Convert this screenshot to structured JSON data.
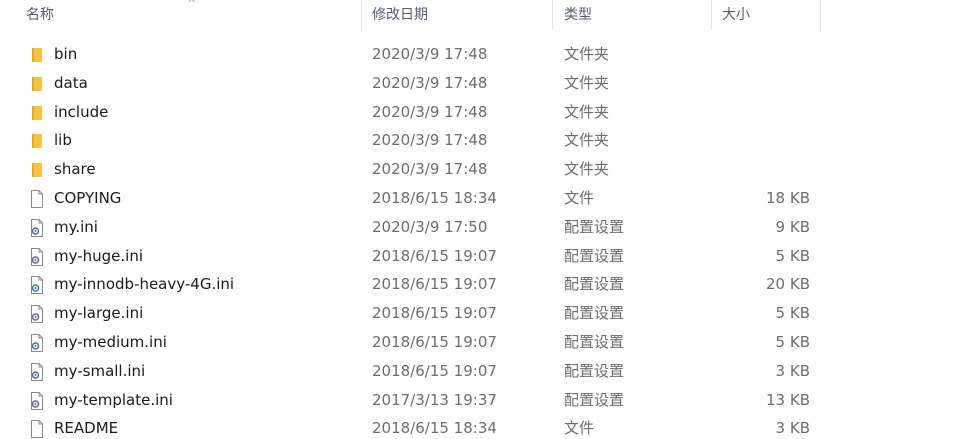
{
  "columns": {
    "name": "名称",
    "date": "修改日期",
    "type": "类型",
    "size": "大小"
  },
  "files": [
    {
      "name": "bin",
      "date": "2020/3/9 17:48",
      "type": "文件夹",
      "size": "",
      "icon": "folder-icon"
    },
    {
      "name": "data",
      "date": "2020/3/9 17:48",
      "type": "文件夹",
      "size": "",
      "icon": "folder-icon"
    },
    {
      "name": "include",
      "date": "2020/3/9 17:48",
      "type": "文件夹",
      "size": "",
      "icon": "folder-icon"
    },
    {
      "name": "lib",
      "date": "2020/3/9 17:48",
      "type": "文件夹",
      "size": "",
      "icon": "folder-icon"
    },
    {
      "name": "share",
      "date": "2020/3/9 17:48",
      "type": "文件夹",
      "size": "",
      "icon": "folder-icon"
    },
    {
      "name": "COPYING",
      "date": "2018/6/15 18:34",
      "type": "文件",
      "size": "18 KB",
      "icon": "file-icon"
    },
    {
      "name": "my.ini",
      "date": "2020/3/9 17:50",
      "type": "配置设置",
      "size": "9 KB",
      "icon": "settings-file-icon"
    },
    {
      "name": "my-huge.ini",
      "date": "2018/6/15 19:07",
      "type": "配置设置",
      "size": "5 KB",
      "icon": "settings-file-icon"
    },
    {
      "name": "my-innodb-heavy-4G.ini",
      "date": "2018/6/15 19:07",
      "type": "配置设置",
      "size": "20 KB",
      "icon": "settings-file-icon"
    },
    {
      "name": "my-large.ini",
      "date": "2018/6/15 19:07",
      "type": "配置设置",
      "size": "5 KB",
      "icon": "settings-file-icon"
    },
    {
      "name": "my-medium.ini",
      "date": "2018/6/15 19:07",
      "type": "配置设置",
      "size": "5 KB",
      "icon": "settings-file-icon"
    },
    {
      "name": "my-small.ini",
      "date": "2018/6/15 19:07",
      "type": "配置设置",
      "size": "3 KB",
      "icon": "settings-file-icon"
    },
    {
      "name": "my-template.ini",
      "date": "2017/3/13 19:37",
      "type": "配置设置",
      "size": "13 KB",
      "icon": "settings-file-icon"
    },
    {
      "name": "README",
      "date": "2018/6/15 18:34",
      "type": "文件",
      "size": "3 KB",
      "icon": "file-icon"
    }
  ]
}
